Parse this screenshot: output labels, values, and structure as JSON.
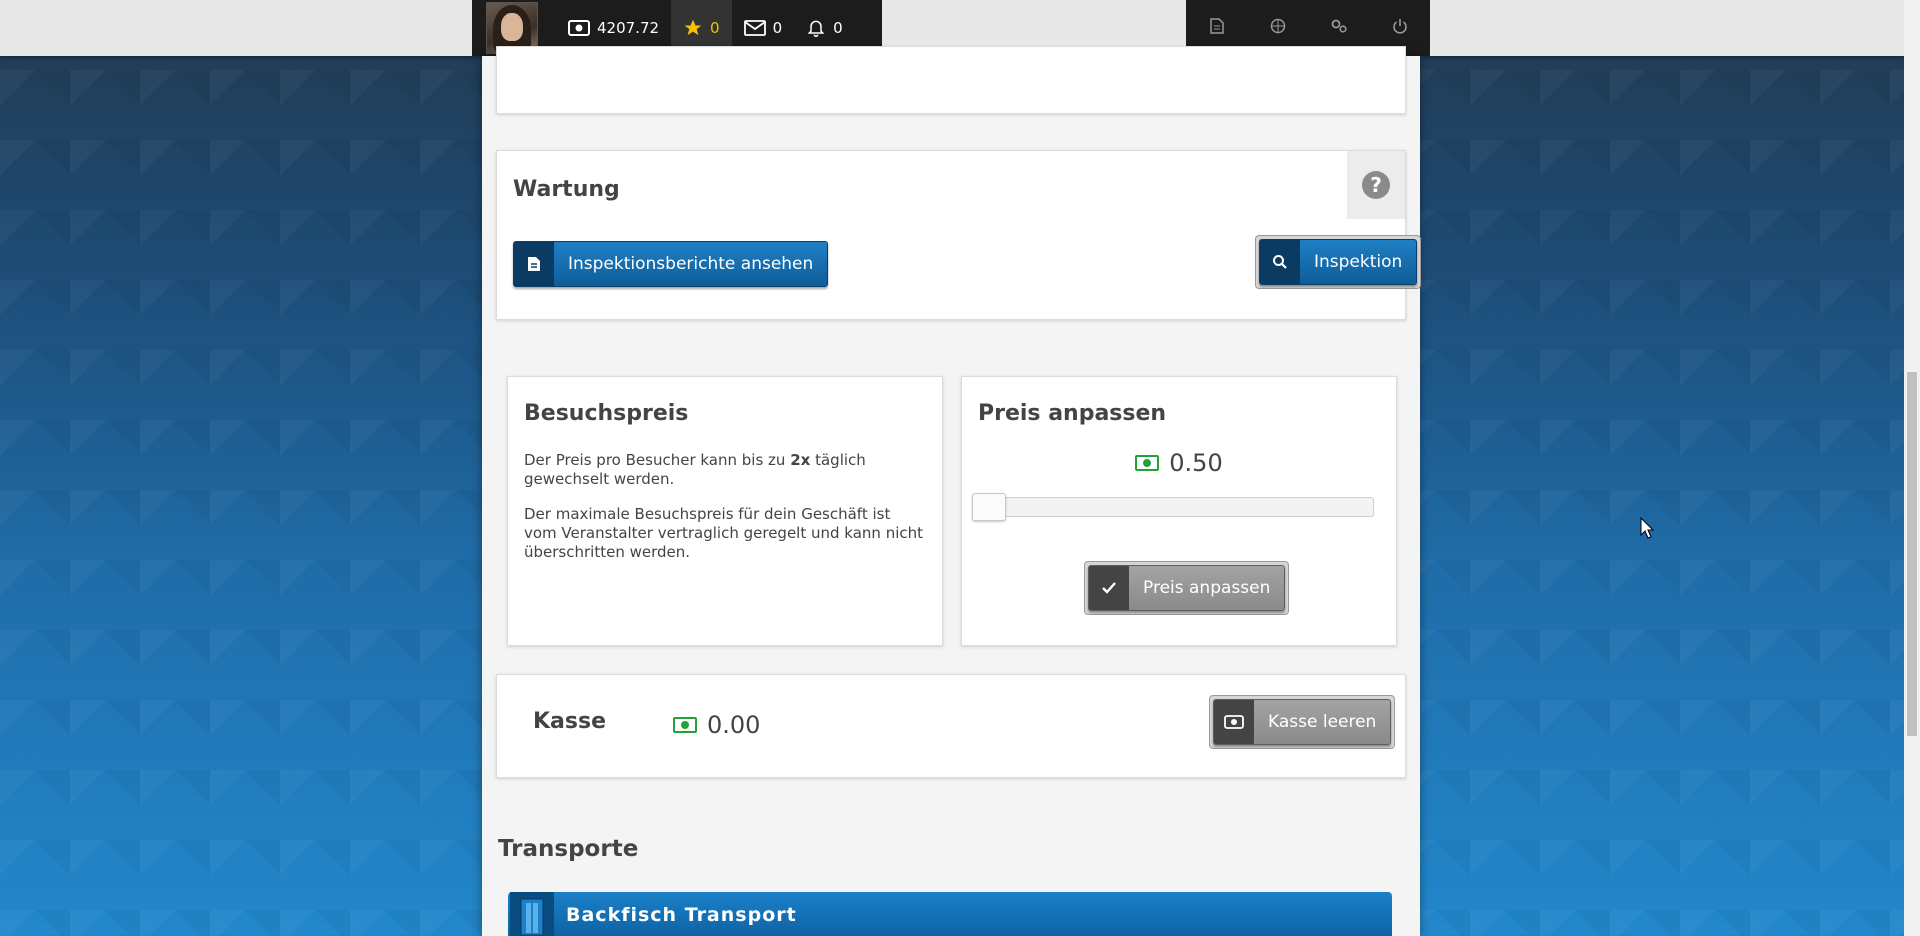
{
  "topbar": {
    "money": "4207.72",
    "stars": "0",
    "messages": "0",
    "notifications": "0",
    "icons_right": [
      "document-icon",
      "globe-icon",
      "settings-icon",
      "power-icon"
    ]
  },
  "wartung": {
    "title": "Wartung",
    "help": "?",
    "reports_button": "Inspektionsberichte ansehen",
    "inspect_button": "Inspektion"
  },
  "besuchspreis": {
    "title": "Besuchspreis",
    "text1_pre": "Der Preis pro Besucher kann bis zu ",
    "text1_bold": "2x",
    "text1_post": " täglich gewechselt werden.",
    "text2": "Der maximale Besuchspreis für dein Geschäft ist vom Veranstalter vertraglich geregelt und kann nicht überschritten werden."
  },
  "preis_anpassen": {
    "title": "Preis anpassen",
    "value": "0.50",
    "slider_fraction": 0.0,
    "button": "Preis anpassen"
  },
  "kasse": {
    "title": "Kasse",
    "value": "0.00",
    "button": "Kasse leeren"
  },
  "transporte": {
    "title": "Transporte",
    "item_label": "Backfisch Transport"
  },
  "colors": {
    "accent_blue": "#0f5d99",
    "money_green": "#22a33a",
    "star_yellow": "#f3c300"
  }
}
